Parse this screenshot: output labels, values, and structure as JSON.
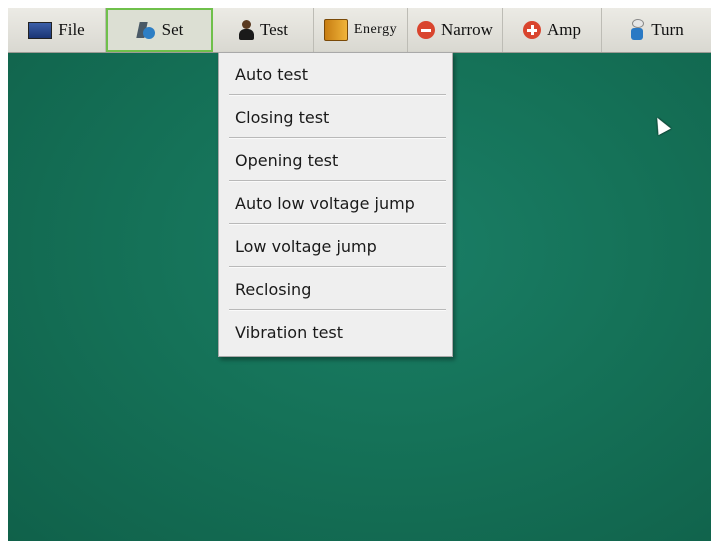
{
  "menubar": {
    "items": [
      {
        "label": "File",
        "icon": "monitor-icon"
      },
      {
        "label": "Set",
        "icon": "set-icon",
        "active": true
      },
      {
        "label": "Test",
        "icon": "person-icon"
      },
      {
        "label": "Energy",
        "icon": "book-icon"
      },
      {
        "label": "Narrow",
        "icon": "minus-circle-icon"
      },
      {
        "label": "Amp",
        "icon": "plus-circle-icon"
      },
      {
        "label": "Turn",
        "icon": "turn-icon"
      }
    ]
  },
  "dropdown": {
    "items": [
      {
        "label": "Auto test"
      },
      {
        "label": "Closing test"
      },
      {
        "label": "Opening test"
      },
      {
        "label": "Auto low voltage jump"
      },
      {
        "label": "Low voltage jump"
      },
      {
        "label": "Reclosing"
      },
      {
        "label": "Vibration test"
      }
    ]
  },
  "colors": {
    "desktop": "#157258",
    "active_border": "#6fc04b",
    "menubar": "#e3e2dc"
  }
}
